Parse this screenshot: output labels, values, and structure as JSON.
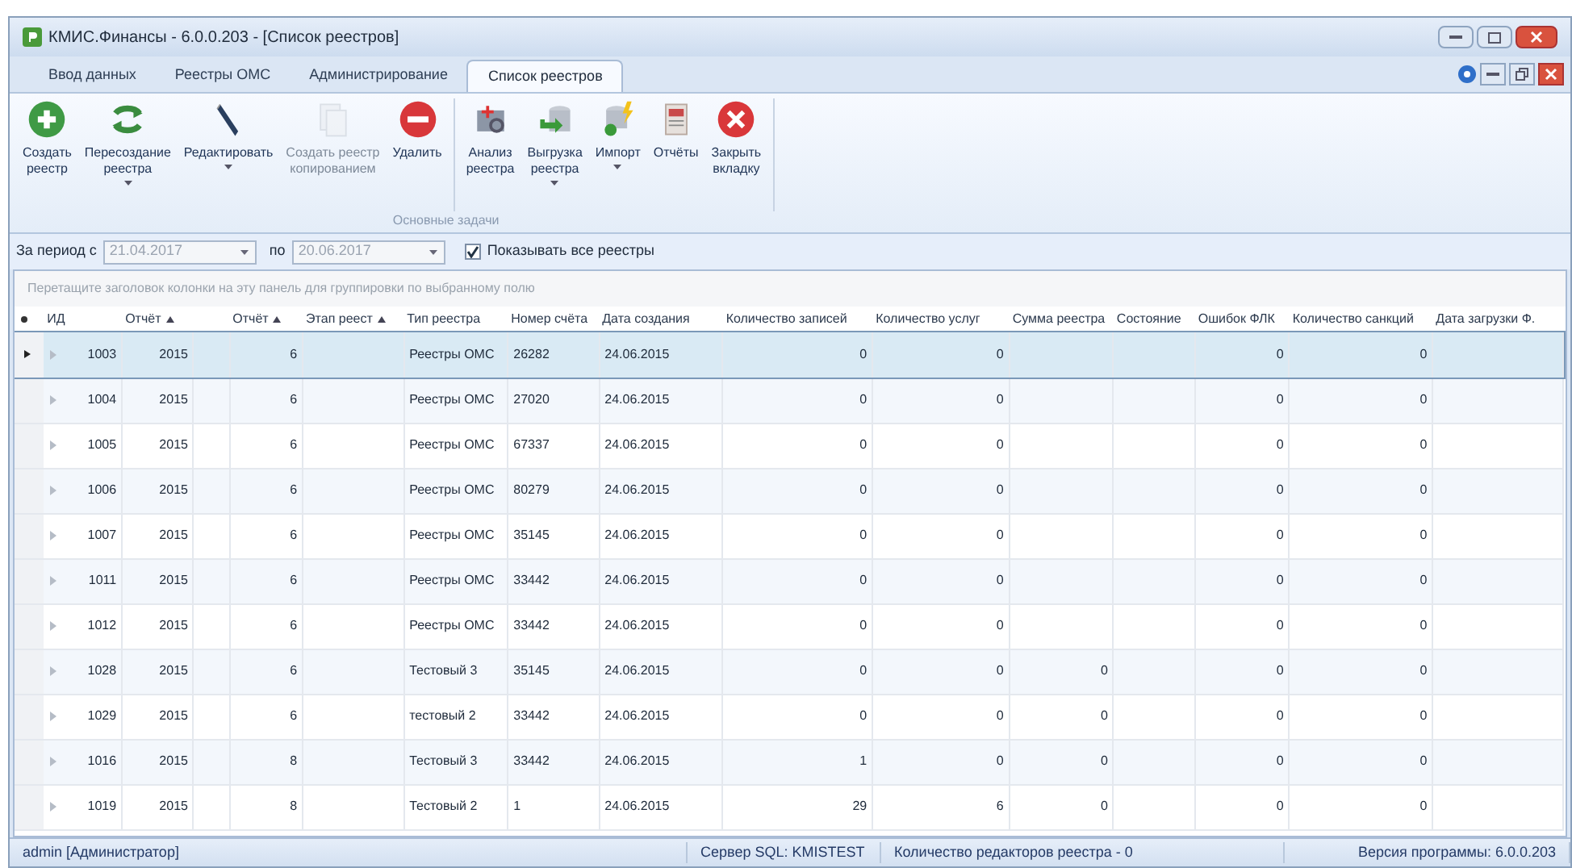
{
  "window": {
    "title": "КМИС.Финансы - 6.0.0.203 - [Список реестров]"
  },
  "tabs": [
    {
      "label": "Ввод данных",
      "selected": false
    },
    {
      "label": "Реестры ОМС",
      "selected": false
    },
    {
      "label": "Администрирование",
      "selected": false
    },
    {
      "label": "Список реестров",
      "selected": true
    }
  ],
  "ribbon": {
    "group_label": "Основные задачи",
    "buttons": [
      {
        "label": "Создать\nреестр",
        "dropdown": false,
        "disabled": false
      },
      {
        "label": "Пересоздание\nреестра",
        "dropdown": true,
        "disabled": false
      },
      {
        "label": "Редактировать",
        "dropdown": true,
        "disabled": false
      },
      {
        "label": "Создать реестр\nкопированием",
        "dropdown": false,
        "disabled": true
      },
      {
        "label": "Удалить",
        "dropdown": false,
        "disabled": false
      },
      {
        "label": "Анализ\nреестра",
        "dropdown": false,
        "disabled": false
      },
      {
        "label": "Выгрузка\nреестра",
        "dropdown": true,
        "disabled": false
      },
      {
        "label": "Импорт",
        "dropdown": true,
        "disabled": false
      },
      {
        "label": "Отчёты",
        "dropdown": false,
        "disabled": false
      },
      {
        "label": "Закрыть\nвкладку",
        "dropdown": false,
        "disabled": false
      }
    ]
  },
  "filter": {
    "from_label": "За период с",
    "from_value": "21.04.2017",
    "to_label": "по",
    "to_value": "20.06.2017",
    "dates_disabled": true,
    "show_all": {
      "label": "Показывать все реестры",
      "checked": true
    }
  },
  "group_panel": "Перетащите заголовок колонки на эту панель для группировки по выбранному полю",
  "table": {
    "columns": [
      {
        "label": "ИД",
        "sorted": false
      },
      {
        "label": "Отчёт",
        "sorted": true
      },
      {
        "label": "Отчёт",
        "sorted": true
      },
      {
        "label": "Этап реест",
        "sorted": true
      },
      {
        "label": "Тип реестра",
        "sorted": false
      },
      {
        "label": "Номер счёта",
        "sorted": false
      },
      {
        "label": "Дата создания",
        "sorted": false
      },
      {
        "label": "Количество записей",
        "sorted": false
      },
      {
        "label": "Количество услуг",
        "sorted": false
      },
      {
        "label": "Сумма реестра",
        "sorted": false
      },
      {
        "label": "Состояние",
        "sorted": false
      },
      {
        "label": "Ошибок ФЛК",
        "sorted": false
      },
      {
        "label": "Количество санкций",
        "sorted": false
      },
      {
        "label": "Дата загрузки Ф.",
        "sorted": false
      }
    ],
    "rows": [
      {
        "selected": true,
        "cells": [
          "1003",
          "2015",
          "6",
          null,
          "Реестры ОМС",
          "26282",
          "24.06.2015",
          "0",
          "0",
          null,
          null,
          "0",
          "0",
          null
        ]
      },
      {
        "selected": false,
        "cells": [
          "1004",
          "2015",
          "6",
          null,
          "Реестры ОМС",
          "27020",
          "24.06.2015",
          "0",
          "0",
          null,
          null,
          "0",
          "0",
          null
        ]
      },
      {
        "selected": false,
        "cells": [
          "1005",
          "2015",
          "6",
          null,
          "Реестры ОМС",
          "67337",
          "24.06.2015",
          "0",
          "0",
          null,
          null,
          "0",
          "0",
          null
        ]
      },
      {
        "selected": false,
        "cells": [
          "1006",
          "2015",
          "6",
          null,
          "Реестры ОМС",
          "80279",
          "24.06.2015",
          "0",
          "0",
          null,
          null,
          "0",
          "0",
          null
        ]
      },
      {
        "selected": false,
        "cells": [
          "1007",
          "2015",
          "6",
          null,
          "Реестры ОМС",
          "35145",
          "24.06.2015",
          "0",
          "0",
          null,
          null,
          "0",
          "0",
          null
        ]
      },
      {
        "selected": false,
        "cells": [
          "1011",
          "2015",
          "6",
          null,
          "Реестры ОМС",
          "33442",
          "24.06.2015",
          "0",
          "0",
          null,
          null,
          "0",
          "0",
          null
        ]
      },
      {
        "selected": false,
        "cells": [
          "1012",
          "2015",
          "6",
          null,
          "Реестры ОМС",
          "33442",
          "24.06.2015",
          "0",
          "0",
          null,
          null,
          "0",
          "0",
          null
        ]
      },
      {
        "selected": false,
        "cells": [
          "1028",
          "2015",
          "6",
          null,
          "Тестовый 3",
          "35145",
          "24.06.2015",
          "0",
          "0",
          "0",
          null,
          "0",
          "0",
          null
        ]
      },
      {
        "selected": false,
        "cells": [
          "1029",
          "2015",
          "6",
          null,
          "тестовый 2",
          "33442",
          "24.06.2015",
          "0",
          "0",
          "0",
          null,
          "0",
          "0",
          null
        ]
      },
      {
        "selected": false,
        "cells": [
          "1016",
          "2015",
          "8",
          null,
          "Тестовый 3",
          "33442",
          "24.06.2015",
          "1",
          "0",
          "0",
          null,
          "0",
          "0",
          null
        ]
      },
      {
        "selected": false,
        "cells": [
          "1019",
          "2015",
          "8",
          null,
          "Тестовый 2",
          "1",
          "24.06.2015",
          "29",
          "6",
          "0",
          null,
          "0",
          "0",
          null
        ]
      }
    ]
  },
  "status_bar": [
    "admin [Администратор]",
    "Сервер SQL: KMISTEST",
    "Количество редакторов реестра - 0",
    "Версия программы: 6.0.0.203"
  ]
}
